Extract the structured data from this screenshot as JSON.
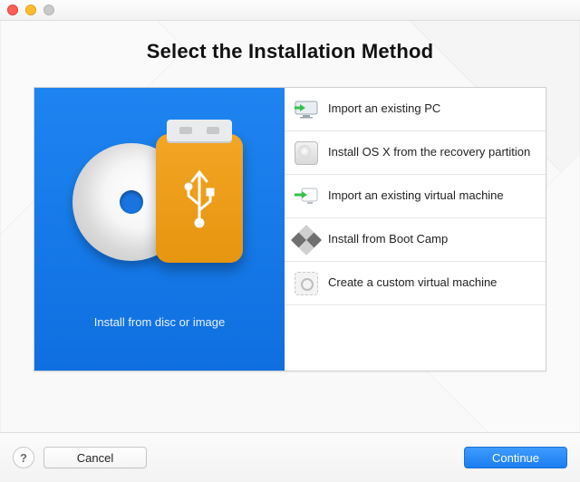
{
  "title": "Select the Installation Method",
  "preview": {
    "caption": "Install from disc or image"
  },
  "options": [
    {
      "label": "Import an existing PC"
    },
    {
      "label": "Install OS X from the recovery partition"
    },
    {
      "label": "Import an existing virtual machine"
    },
    {
      "label": "Install from Boot Camp"
    },
    {
      "label": "Create a custom virtual machine"
    }
  ],
  "footer": {
    "help": "?",
    "cancel": "Cancel",
    "continue": "Continue"
  }
}
